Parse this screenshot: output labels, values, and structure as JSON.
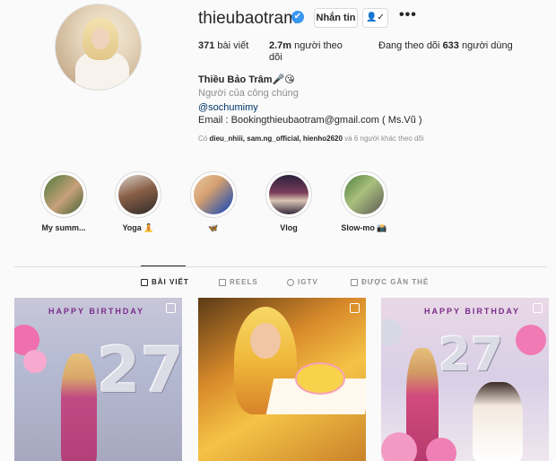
{
  "profile": {
    "username": "thieubaotram",
    "verified_mark": "✔",
    "message_button": "Nhắn tin",
    "follow_button": "✓",
    "more_icon": "•••",
    "posts_count": "371",
    "posts_label": "bài viết",
    "followers_count": "2.7m",
    "followers_label": "người theo dõi",
    "following_prefix": "Đang theo dõi",
    "following_count": "633",
    "following_suffix": "người dùng",
    "full_name": "Thiều Bảo Trâm🎤😘",
    "category": "Người của công chúng",
    "mention": "@sochumimy",
    "email": "Email : Bookingthieubaotram@gmail.com ( Ms.Vũ )",
    "followed_by_prefix": "Có",
    "followed_by_names": "dieu_nhiii, sam.ng_official, hienho2620",
    "followed_by_suffix": "và 6 người khác theo dõi"
  },
  "highlights": [
    {
      "label": "My summ..."
    },
    {
      "label": "Yoga 🧘"
    },
    {
      "label": "🦋"
    },
    {
      "label": "Vlog"
    },
    {
      "label": "Slow-mo 📸"
    }
  ],
  "tabs": [
    {
      "label": "BÀI VIẾT",
      "icon": "grid-icon",
      "active": true
    },
    {
      "label": "REELS",
      "icon": "reels-icon",
      "active": false
    },
    {
      "label": "IGTV",
      "icon": "igtv-icon",
      "active": false
    },
    {
      "label": "ĐƯỢC GẮN THẺ",
      "icon": "tagged-icon",
      "active": false
    }
  ],
  "posts": [
    {
      "banner": "HAPPY BIRTHDAY",
      "number": "27"
    },
    {
      "banner": "",
      "number": ""
    },
    {
      "banner": "HAPPY BIRTHDAY",
      "number": "27"
    }
  ],
  "colors": {
    "verified": "#3897f0",
    "link": "#00376b",
    "muted": "#8e8e8e"
  }
}
